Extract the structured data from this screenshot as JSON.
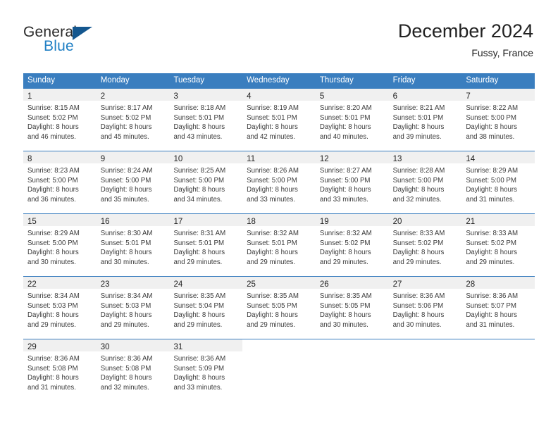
{
  "logo": {
    "word_general": "General",
    "word_blue": "Blue",
    "triangle_color": "#14578f",
    "blue_color": "#1f7fc4"
  },
  "header": {
    "title": "December 2024",
    "location": "Fussy, France"
  },
  "theme": {
    "header_blue": "#3a7ebf",
    "daynum_band": "#f0f0f0",
    "text": "#222222"
  },
  "calendar": {
    "weekday_headers": [
      "Sunday",
      "Monday",
      "Tuesday",
      "Wednesday",
      "Thursday",
      "Friday",
      "Saturday"
    ],
    "weeks": [
      [
        {
          "day": "1",
          "sunrise": "Sunrise: 8:15 AM",
          "sunset": "Sunset: 5:02 PM",
          "daylight1": "Daylight: 8 hours",
          "daylight2": "and 46 minutes."
        },
        {
          "day": "2",
          "sunrise": "Sunrise: 8:17 AM",
          "sunset": "Sunset: 5:02 PM",
          "daylight1": "Daylight: 8 hours",
          "daylight2": "and 45 minutes."
        },
        {
          "day": "3",
          "sunrise": "Sunrise: 8:18 AM",
          "sunset": "Sunset: 5:01 PM",
          "daylight1": "Daylight: 8 hours",
          "daylight2": "and 43 minutes."
        },
        {
          "day": "4",
          "sunrise": "Sunrise: 8:19 AM",
          "sunset": "Sunset: 5:01 PM",
          "daylight1": "Daylight: 8 hours",
          "daylight2": "and 42 minutes."
        },
        {
          "day": "5",
          "sunrise": "Sunrise: 8:20 AM",
          "sunset": "Sunset: 5:01 PM",
          "daylight1": "Daylight: 8 hours",
          "daylight2": "and 40 minutes."
        },
        {
          "day": "6",
          "sunrise": "Sunrise: 8:21 AM",
          "sunset": "Sunset: 5:01 PM",
          "daylight1": "Daylight: 8 hours",
          "daylight2": "and 39 minutes."
        },
        {
          "day": "7",
          "sunrise": "Sunrise: 8:22 AM",
          "sunset": "Sunset: 5:00 PM",
          "daylight1": "Daylight: 8 hours",
          "daylight2": "and 38 minutes."
        }
      ],
      [
        {
          "day": "8",
          "sunrise": "Sunrise: 8:23 AM",
          "sunset": "Sunset: 5:00 PM",
          "daylight1": "Daylight: 8 hours",
          "daylight2": "and 36 minutes."
        },
        {
          "day": "9",
          "sunrise": "Sunrise: 8:24 AM",
          "sunset": "Sunset: 5:00 PM",
          "daylight1": "Daylight: 8 hours",
          "daylight2": "and 35 minutes."
        },
        {
          "day": "10",
          "sunrise": "Sunrise: 8:25 AM",
          "sunset": "Sunset: 5:00 PM",
          "daylight1": "Daylight: 8 hours",
          "daylight2": "and 34 minutes."
        },
        {
          "day": "11",
          "sunrise": "Sunrise: 8:26 AM",
          "sunset": "Sunset: 5:00 PM",
          "daylight1": "Daylight: 8 hours",
          "daylight2": "and 33 minutes."
        },
        {
          "day": "12",
          "sunrise": "Sunrise: 8:27 AM",
          "sunset": "Sunset: 5:00 PM",
          "daylight1": "Daylight: 8 hours",
          "daylight2": "and 33 minutes."
        },
        {
          "day": "13",
          "sunrise": "Sunrise: 8:28 AM",
          "sunset": "Sunset: 5:00 PM",
          "daylight1": "Daylight: 8 hours",
          "daylight2": "and 32 minutes."
        },
        {
          "day": "14",
          "sunrise": "Sunrise: 8:29 AM",
          "sunset": "Sunset: 5:00 PM",
          "daylight1": "Daylight: 8 hours",
          "daylight2": "and 31 minutes."
        }
      ],
      [
        {
          "day": "15",
          "sunrise": "Sunrise: 8:29 AM",
          "sunset": "Sunset: 5:00 PM",
          "daylight1": "Daylight: 8 hours",
          "daylight2": "and 30 minutes."
        },
        {
          "day": "16",
          "sunrise": "Sunrise: 8:30 AM",
          "sunset": "Sunset: 5:01 PM",
          "daylight1": "Daylight: 8 hours",
          "daylight2": "and 30 minutes."
        },
        {
          "day": "17",
          "sunrise": "Sunrise: 8:31 AM",
          "sunset": "Sunset: 5:01 PM",
          "daylight1": "Daylight: 8 hours",
          "daylight2": "and 29 minutes."
        },
        {
          "day": "18",
          "sunrise": "Sunrise: 8:32 AM",
          "sunset": "Sunset: 5:01 PM",
          "daylight1": "Daylight: 8 hours",
          "daylight2": "and 29 minutes."
        },
        {
          "day": "19",
          "sunrise": "Sunrise: 8:32 AM",
          "sunset": "Sunset: 5:02 PM",
          "daylight1": "Daylight: 8 hours",
          "daylight2": "and 29 minutes."
        },
        {
          "day": "20",
          "sunrise": "Sunrise: 8:33 AM",
          "sunset": "Sunset: 5:02 PM",
          "daylight1": "Daylight: 8 hours",
          "daylight2": "and 29 minutes."
        },
        {
          "day": "21",
          "sunrise": "Sunrise: 8:33 AM",
          "sunset": "Sunset: 5:02 PM",
          "daylight1": "Daylight: 8 hours",
          "daylight2": "and 29 minutes."
        }
      ],
      [
        {
          "day": "22",
          "sunrise": "Sunrise: 8:34 AM",
          "sunset": "Sunset: 5:03 PM",
          "daylight1": "Daylight: 8 hours",
          "daylight2": "and 29 minutes."
        },
        {
          "day": "23",
          "sunrise": "Sunrise: 8:34 AM",
          "sunset": "Sunset: 5:03 PM",
          "daylight1": "Daylight: 8 hours",
          "daylight2": "and 29 minutes."
        },
        {
          "day": "24",
          "sunrise": "Sunrise: 8:35 AM",
          "sunset": "Sunset: 5:04 PM",
          "daylight1": "Daylight: 8 hours",
          "daylight2": "and 29 minutes."
        },
        {
          "day": "25",
          "sunrise": "Sunrise: 8:35 AM",
          "sunset": "Sunset: 5:05 PM",
          "daylight1": "Daylight: 8 hours",
          "daylight2": "and 29 minutes."
        },
        {
          "day": "26",
          "sunrise": "Sunrise: 8:35 AM",
          "sunset": "Sunset: 5:05 PM",
          "daylight1": "Daylight: 8 hours",
          "daylight2": "and 30 minutes."
        },
        {
          "day": "27",
          "sunrise": "Sunrise: 8:36 AM",
          "sunset": "Sunset: 5:06 PM",
          "daylight1": "Daylight: 8 hours",
          "daylight2": "and 30 minutes."
        },
        {
          "day": "28",
          "sunrise": "Sunrise: 8:36 AM",
          "sunset": "Sunset: 5:07 PM",
          "daylight1": "Daylight: 8 hours",
          "daylight2": "and 31 minutes."
        }
      ],
      [
        {
          "day": "29",
          "sunrise": "Sunrise: 8:36 AM",
          "sunset": "Sunset: 5:08 PM",
          "daylight1": "Daylight: 8 hours",
          "daylight2": "and 31 minutes."
        },
        {
          "day": "30",
          "sunrise": "Sunrise: 8:36 AM",
          "sunset": "Sunset: 5:08 PM",
          "daylight1": "Daylight: 8 hours",
          "daylight2": "and 32 minutes."
        },
        {
          "day": "31",
          "sunrise": "Sunrise: 8:36 AM",
          "sunset": "Sunset: 5:09 PM",
          "daylight1": "Daylight: 8 hours",
          "daylight2": "and 33 minutes."
        },
        {
          "day": "",
          "sunrise": "",
          "sunset": "",
          "daylight1": "",
          "daylight2": ""
        },
        {
          "day": "",
          "sunrise": "",
          "sunset": "",
          "daylight1": "",
          "daylight2": ""
        },
        {
          "day": "",
          "sunrise": "",
          "sunset": "",
          "daylight1": "",
          "daylight2": ""
        },
        {
          "day": "",
          "sunrise": "",
          "sunset": "",
          "daylight1": "",
          "daylight2": ""
        }
      ]
    ]
  }
}
